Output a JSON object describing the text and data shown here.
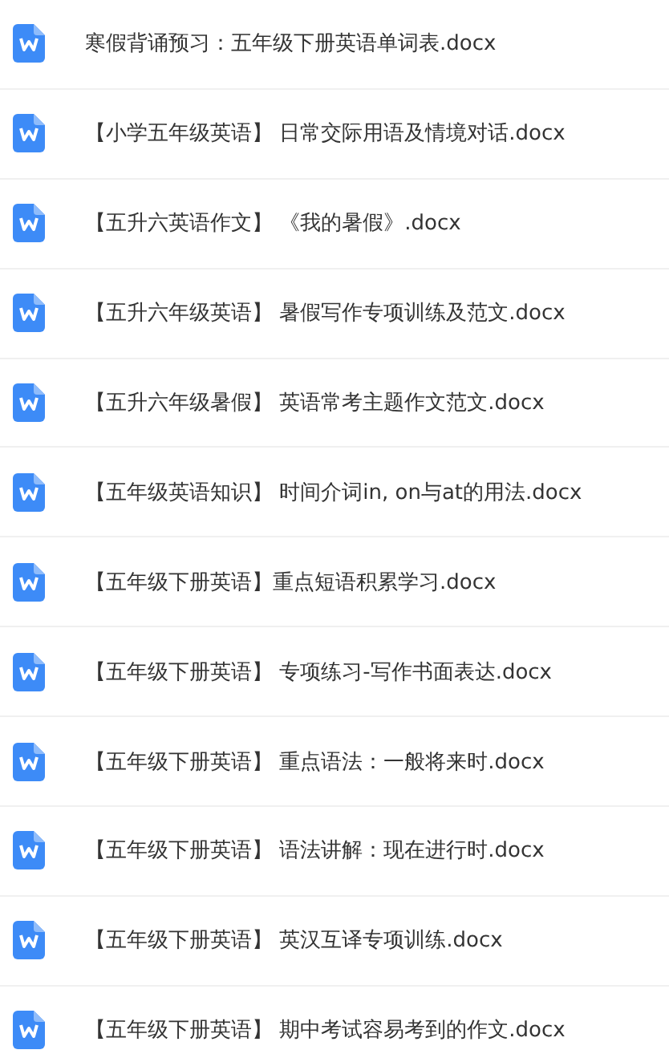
{
  "files": [
    {
      "name": "寒假背诵预习：五年级下册英语单词表.docx"
    },
    {
      "name": "【小学五年级英语】 日常交际用语及情境对话.docx"
    },
    {
      "name": "【五升六英语作文】 《我的暑假》.docx"
    },
    {
      "name": "【五升六年级英语】 暑假写作专项训练及范文.docx"
    },
    {
      "name": "【五升六年级暑假】 英语常考主题作文范文.docx"
    },
    {
      "name": "【五年级英语知识】 时间介词in, on与at的用法.docx"
    },
    {
      "name": "【五年级下册英语】重点短语积累学习.docx"
    },
    {
      "name": "【五年级下册英语】 专项练习-写作书面表达.docx"
    },
    {
      "name": "【五年级下册英语】 重点语法：一般将来时.docx"
    },
    {
      "name": "【五年级下册英语】 语法讲解：现在进行时.docx"
    },
    {
      "name": "【五年级下册英语】 英汉互译专项训练.docx"
    },
    {
      "name": "【五年级下册英语】 期中考试容易考到的作文.docx"
    }
  ]
}
